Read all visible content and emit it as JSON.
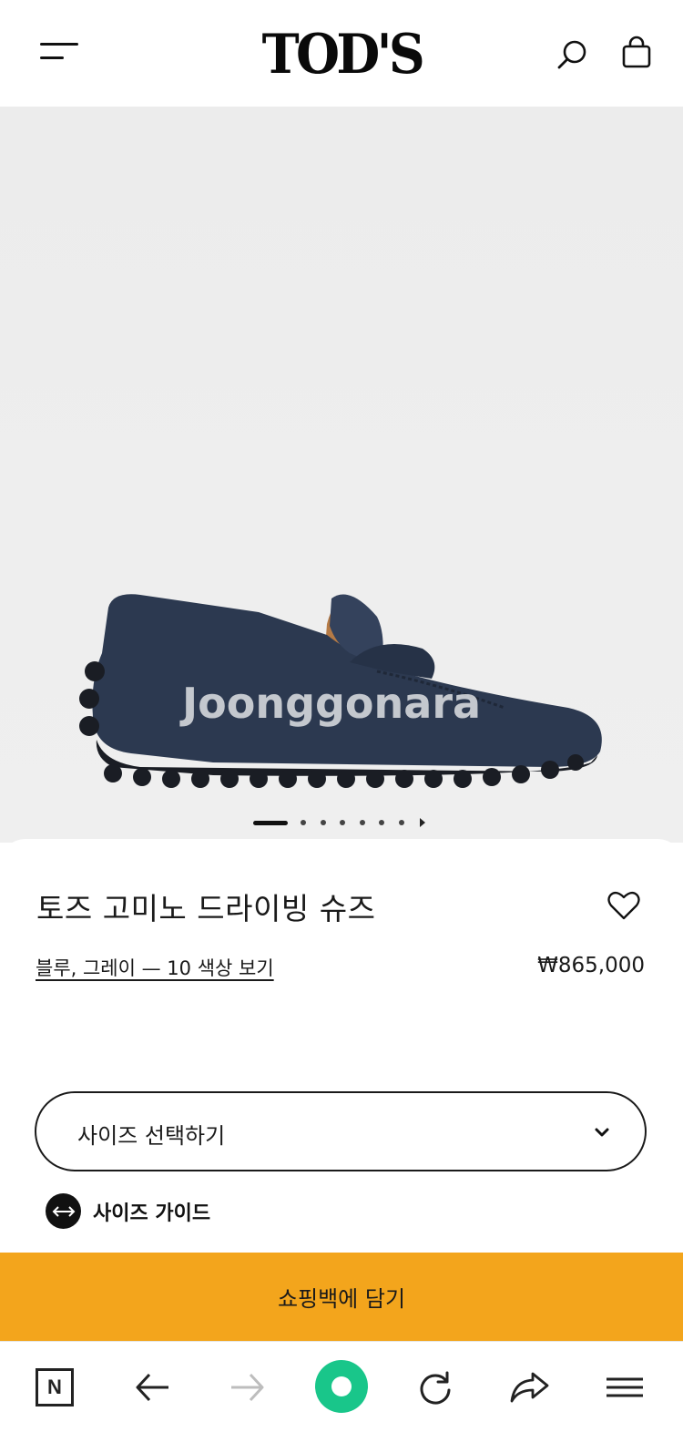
{
  "header": {
    "logo": "TOD'S",
    "icons": {
      "menu": "hamburger-icon",
      "search": "search-icon",
      "bag": "shopping-bag-icon"
    }
  },
  "gallery": {
    "watermark": "Joonggonara",
    "total_slides": 8,
    "current_slide": 1,
    "colors": {
      "shoe": "#2c3950",
      "sole": "#1a1d24",
      "lining": "#b57a45"
    }
  },
  "product": {
    "title": "토즈 고미노 드라이빙 슈즈",
    "color_link": "블루, 그레이 — 10 색상 보기",
    "price": "₩865,000",
    "favorite_icon": "heart-outline-icon"
  },
  "size": {
    "select_label": "사이즈 선택하기",
    "select_icon": "chevron-down-icon",
    "guide_label": "사이즈 가이드",
    "guide_icon": "double-arrow-icon"
  },
  "cta": {
    "label": "쇼핑백에 담기",
    "color": "#f3a51c"
  },
  "browser_bar": {
    "items": [
      "naver-n-icon",
      "back-arrow-icon",
      "forward-arrow-icon",
      "home-circle-icon",
      "refresh-icon",
      "share-icon",
      "menu-icon"
    ],
    "home_color": "#19c68a"
  }
}
